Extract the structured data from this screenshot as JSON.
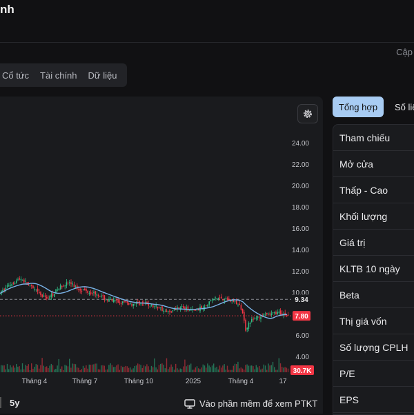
{
  "header": {
    "title": "nh",
    "update_link": "Cập"
  },
  "tabs": [
    "Cổ tức",
    "Tài chính",
    "Dữ liệu"
  ],
  "chart_data": {
    "type": "candlestick",
    "x_ticks": [
      "Tháng 4",
      "Tháng 7",
      "Tháng 10",
      "2025",
      "Tháng 4",
      "17"
    ],
    "y_ticks": [
      "24.00",
      "22.00",
      "20.00",
      "18.00",
      "16.00",
      "14.00",
      "12.00",
      "10.00",
      "8.00",
      "6.00",
      "4.00"
    ],
    "ylim": [
      4,
      24
    ],
    "reference_price": 9.34,
    "reference_price_label": "9.34",
    "last_price": 7.8,
    "last_price_label": "7.80",
    "volume_label": "30.7K",
    "colors": {
      "up": "#2ebd85",
      "down": "#f23645",
      "ma": "#7ab3e8",
      "reference_line": "#8a8d94",
      "last_price_line": "#f23645"
    },
    "price_path": [
      [
        0,
        9.9
      ],
      [
        10,
        10.6
      ],
      [
        20,
        11.0
      ],
      [
        30,
        11.3
      ],
      [
        40,
        10.7
      ],
      [
        50,
        10.2
      ],
      [
        60,
        9.6
      ],
      [
        70,
        9.5
      ],
      [
        80,
        10.1
      ],
      [
        90,
        10.7
      ],
      [
        100,
        10.9
      ],
      [
        110,
        10.4
      ],
      [
        120,
        10.2
      ],
      [
        130,
        10.0
      ],
      [
        140,
        9.9
      ],
      [
        150,
        9.4
      ],
      [
        160,
        9.2
      ],
      [
        170,
        9.1
      ],
      [
        180,
        9.0
      ],
      [
        190,
        8.9
      ],
      [
        200,
        9.0
      ],
      [
        210,
        8.9
      ],
      [
        220,
        8.7
      ],
      [
        230,
        8.6
      ],
      [
        240,
        8.1
      ],
      [
        250,
        8.3
      ],
      [
        260,
        8.7
      ],
      [
        270,
        8.4
      ],
      [
        280,
        8.3
      ],
      [
        290,
        8.5
      ],
      [
        300,
        9.0
      ],
      [
        310,
        9.4
      ],
      [
        320,
        9.5
      ],
      [
        330,
        9.3
      ],
      [
        340,
        9.1
      ],
      [
        350,
        8.4
      ],
      [
        355,
        6.5
      ],
      [
        360,
        7.2
      ],
      [
        370,
        7.6
      ],
      [
        380,
        7.8
      ],
      [
        390,
        7.9
      ],
      [
        400,
        8.1
      ],
      [
        410,
        8.0
      ],
      [
        418,
        7.8
      ]
    ]
  },
  "chart_controls": {
    "range_label": "5y",
    "ptkt_label": "Vào phần mềm để xem PTKT",
    "settings_icon": "gear-icon",
    "monitor_icon": "monitor-icon"
  },
  "right_tabs": {
    "active": "Tổng hợp",
    "second": "Số liệ"
  },
  "stats": [
    "Tham chiếu",
    "Mở cửa",
    "Thấp - Cao",
    "Khối lượng",
    "Giá trị",
    "KLTB 10 ngày",
    "Beta",
    "Thị giá vốn",
    "Số lượng CPLH",
    "P/E",
    "EPS"
  ]
}
